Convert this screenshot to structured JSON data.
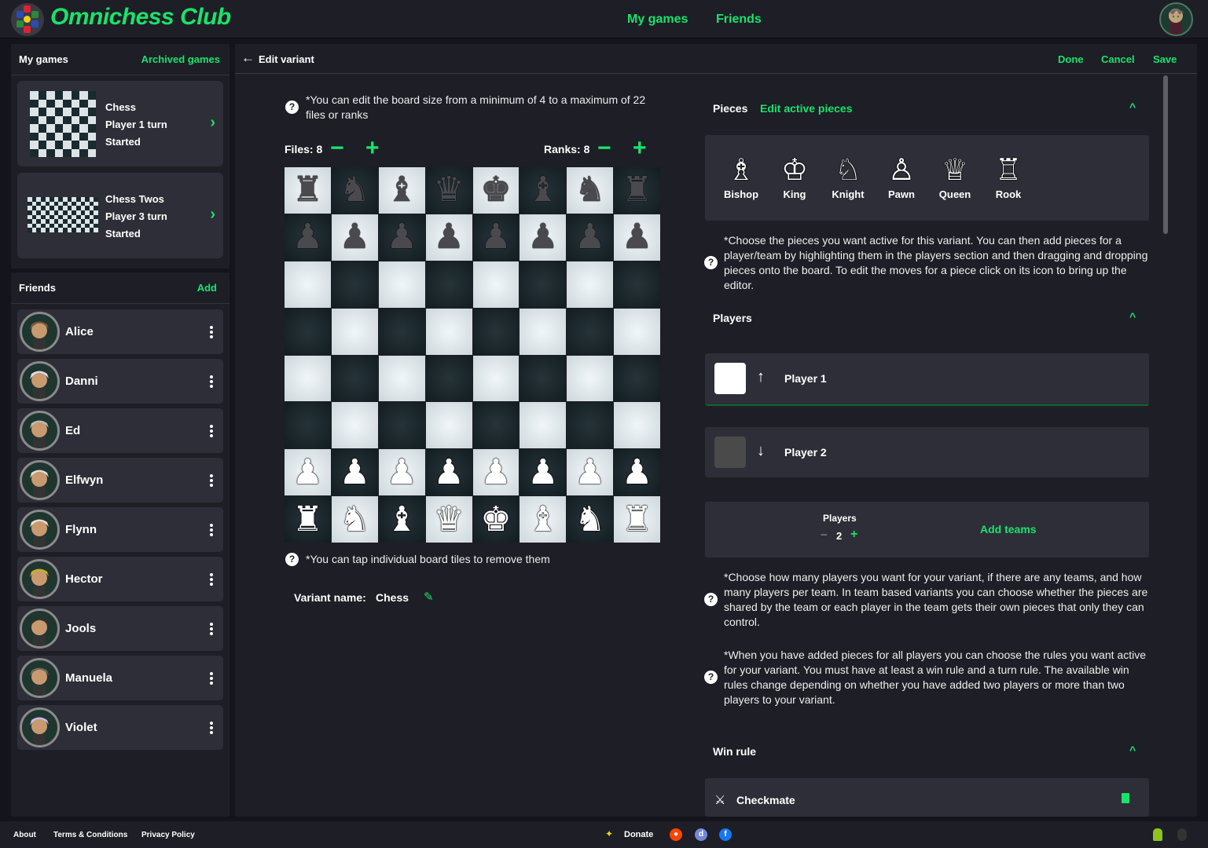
{
  "app": {
    "title": "Omnichess Club"
  },
  "topnav": {
    "my_games": "My games",
    "friends": "Friends"
  },
  "sidebar": {
    "games_title": "My games",
    "archived_link": "Archived games",
    "games": [
      {
        "name": "Chess",
        "turn": "Player 1 turn",
        "status": "Started"
      },
      {
        "name": "Chess Twos",
        "turn": "Player 3 turn",
        "status": "Started"
      }
    ],
    "friends_title": "Friends",
    "add_link": "Add",
    "friends": [
      {
        "name": "Alice"
      },
      {
        "name": "Danni"
      },
      {
        "name": "Ed"
      },
      {
        "name": "Elfwyn"
      },
      {
        "name": "Flynn"
      },
      {
        "name": "Hector"
      },
      {
        "name": "Jools"
      },
      {
        "name": "Manuela"
      },
      {
        "name": "Violet"
      }
    ]
  },
  "editor": {
    "back_label": "Edit variant",
    "done": "Done",
    "cancel": "Cancel",
    "save": "Save",
    "board_note": "*You can edit the board size from a minimum of 4 to a maximum of 22 files or ranks",
    "files_label": "Files: 8",
    "ranks_label": "Ranks: 8",
    "files": 8,
    "ranks": 8,
    "board": [
      [
        "bR",
        "bN",
        "bB",
        "bQ",
        "bK",
        "bB",
        "bN",
        "bR"
      ],
      [
        "bP",
        "bP",
        "bP",
        "bP",
        "bP",
        "bP",
        "bP",
        "bP"
      ],
      [
        "",
        "",
        "",
        "",
        "",
        "",
        "",
        ""
      ],
      [
        "",
        "",
        "",
        "",
        "",
        "",
        "",
        ""
      ],
      [
        "",
        "",
        "",
        "",
        "",
        "",
        "",
        ""
      ],
      [
        "",
        "",
        "",
        "",
        "",
        "",
        "",
        ""
      ],
      [
        "wP",
        "wP",
        "wP",
        "wP",
        "wP",
        "wP",
        "wP",
        "wP"
      ],
      [
        "wR",
        "wN",
        "wB",
        "wQ",
        "wK",
        "wB",
        "wN",
        "wR"
      ]
    ],
    "tiles_note": "*You can tap individual board tiles to remove them",
    "variant_name_label": "Variant name:",
    "variant_name": "Chess"
  },
  "pieces_section": {
    "title": "Pieces",
    "edit_link": "Edit active pieces",
    "pieces": [
      {
        "name": "Bishop",
        "glyph": "♗"
      },
      {
        "name": "King",
        "glyph": "♔"
      },
      {
        "name": "Knight",
        "glyph": "♘"
      },
      {
        "name": "Pawn",
        "glyph": "♙"
      },
      {
        "name": "Queen",
        "glyph": "♕"
      },
      {
        "name": "Rook",
        "glyph": "♖"
      }
    ],
    "note": "*Choose the pieces you want active for this variant. You can then add pieces for a player/team by highlighting them in the players section and then dragging and dropping pieces onto the board. To edit the moves for a piece click on its icon to bring up the editor."
  },
  "players_section": {
    "title": "Players",
    "players": [
      {
        "name": "Player 1",
        "direction": "up",
        "color": "#ffffff",
        "selected": true
      },
      {
        "name": "Player 2",
        "direction": "down",
        "color": "#4a4a4a",
        "selected": false
      }
    ],
    "count_label": "Players",
    "count": "2",
    "add_teams": "Add teams",
    "note1": "*Choose how many players you want for your variant, if there are any teams, and how many players per team. In team based variants you can choose whether the pieces are shared by the team or each player in the team gets their own pieces that only they can control.",
    "note2": "*When you have added pieces for all players you can choose the rules you want active for your variant. You must have at least a win rule and a turn rule. The available win rules change depending on whether you have added two players or more than two players to your variant."
  },
  "win_rule": {
    "title": "Win rule",
    "rules": [
      {
        "name": "Checkmate"
      }
    ]
  },
  "footer": {
    "about": "About",
    "terms": "Terms & Conditions",
    "privacy": "Privacy Policy",
    "donate": "Donate"
  },
  "colors": {
    "accent": "#19e36b",
    "bg": "#1e1e26",
    "card": "#2e2e38"
  }
}
